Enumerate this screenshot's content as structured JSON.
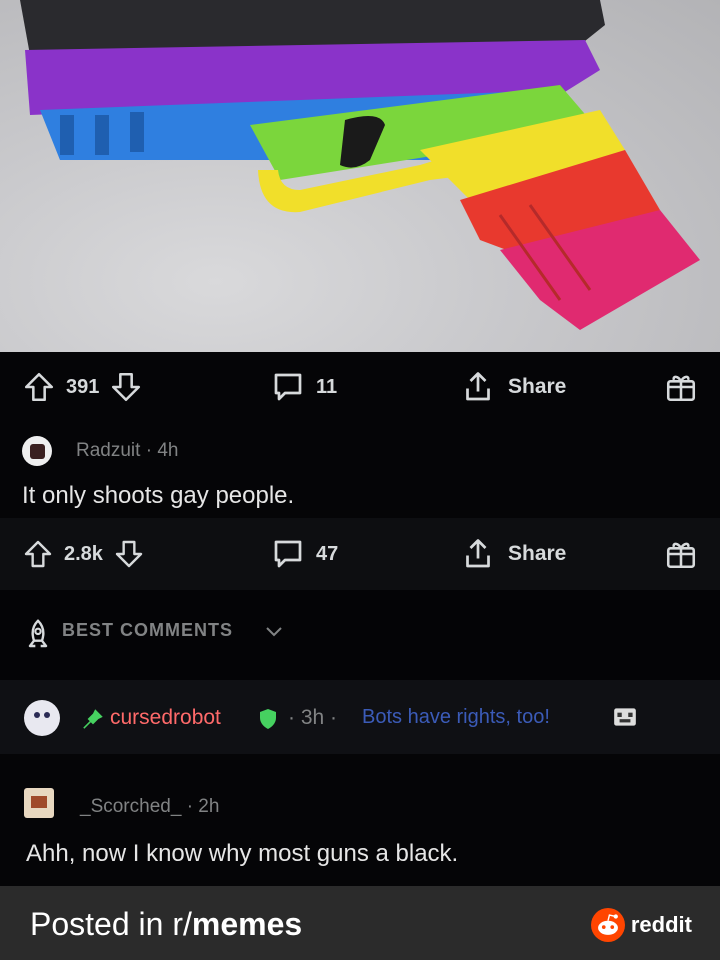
{
  "post": {
    "upvotes": "391",
    "comments": "11",
    "share_label": "Share"
  },
  "comment": {
    "author": "Radzuit",
    "age": "4h",
    "text": "It only shoots gay people.",
    "upvotes": "2.8k",
    "replies": "47",
    "share_label": "Share"
  },
  "sort": {
    "label": "BEST COMMENTS"
  },
  "bot_comment": {
    "author": "cursedrobot",
    "age": "3h",
    "flair": "Bots have rights, too!"
  },
  "reply": {
    "author": "_Scorched_",
    "age": "2h",
    "text": "Ahh, now I know why most guns a black."
  },
  "footer": {
    "posted_prefix": "Posted in r/",
    "subreddit": "memes",
    "brand": "reddit"
  },
  "colors": {
    "background": "#000000",
    "footer_bg": "#2b2b2b",
    "reddit_orange": "#ff4500",
    "bot_name": "#ff6a6a",
    "flair": "#3b5bb8",
    "mod_shield": "#46d160"
  }
}
